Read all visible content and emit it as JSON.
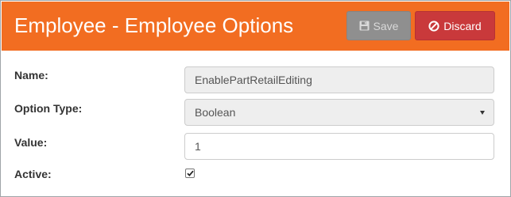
{
  "header": {
    "title": "Employee - Employee Options",
    "save_label": "Save",
    "discard_label": "Discard",
    "save_icon": "floppy-disk-icon",
    "discard_icon": "ban-icon"
  },
  "form": {
    "name": {
      "label": "Name:",
      "value": "EnablePartRetailEditing"
    },
    "option_type": {
      "label": "Option Type:",
      "value": "Boolean"
    },
    "value": {
      "label": "Value:",
      "value": "1"
    },
    "active": {
      "label": "Active:",
      "checked": true
    }
  },
  "colors": {
    "header": "#f26d21",
    "save_button": "#8f8f8f",
    "discard_button": "#c9393b"
  }
}
